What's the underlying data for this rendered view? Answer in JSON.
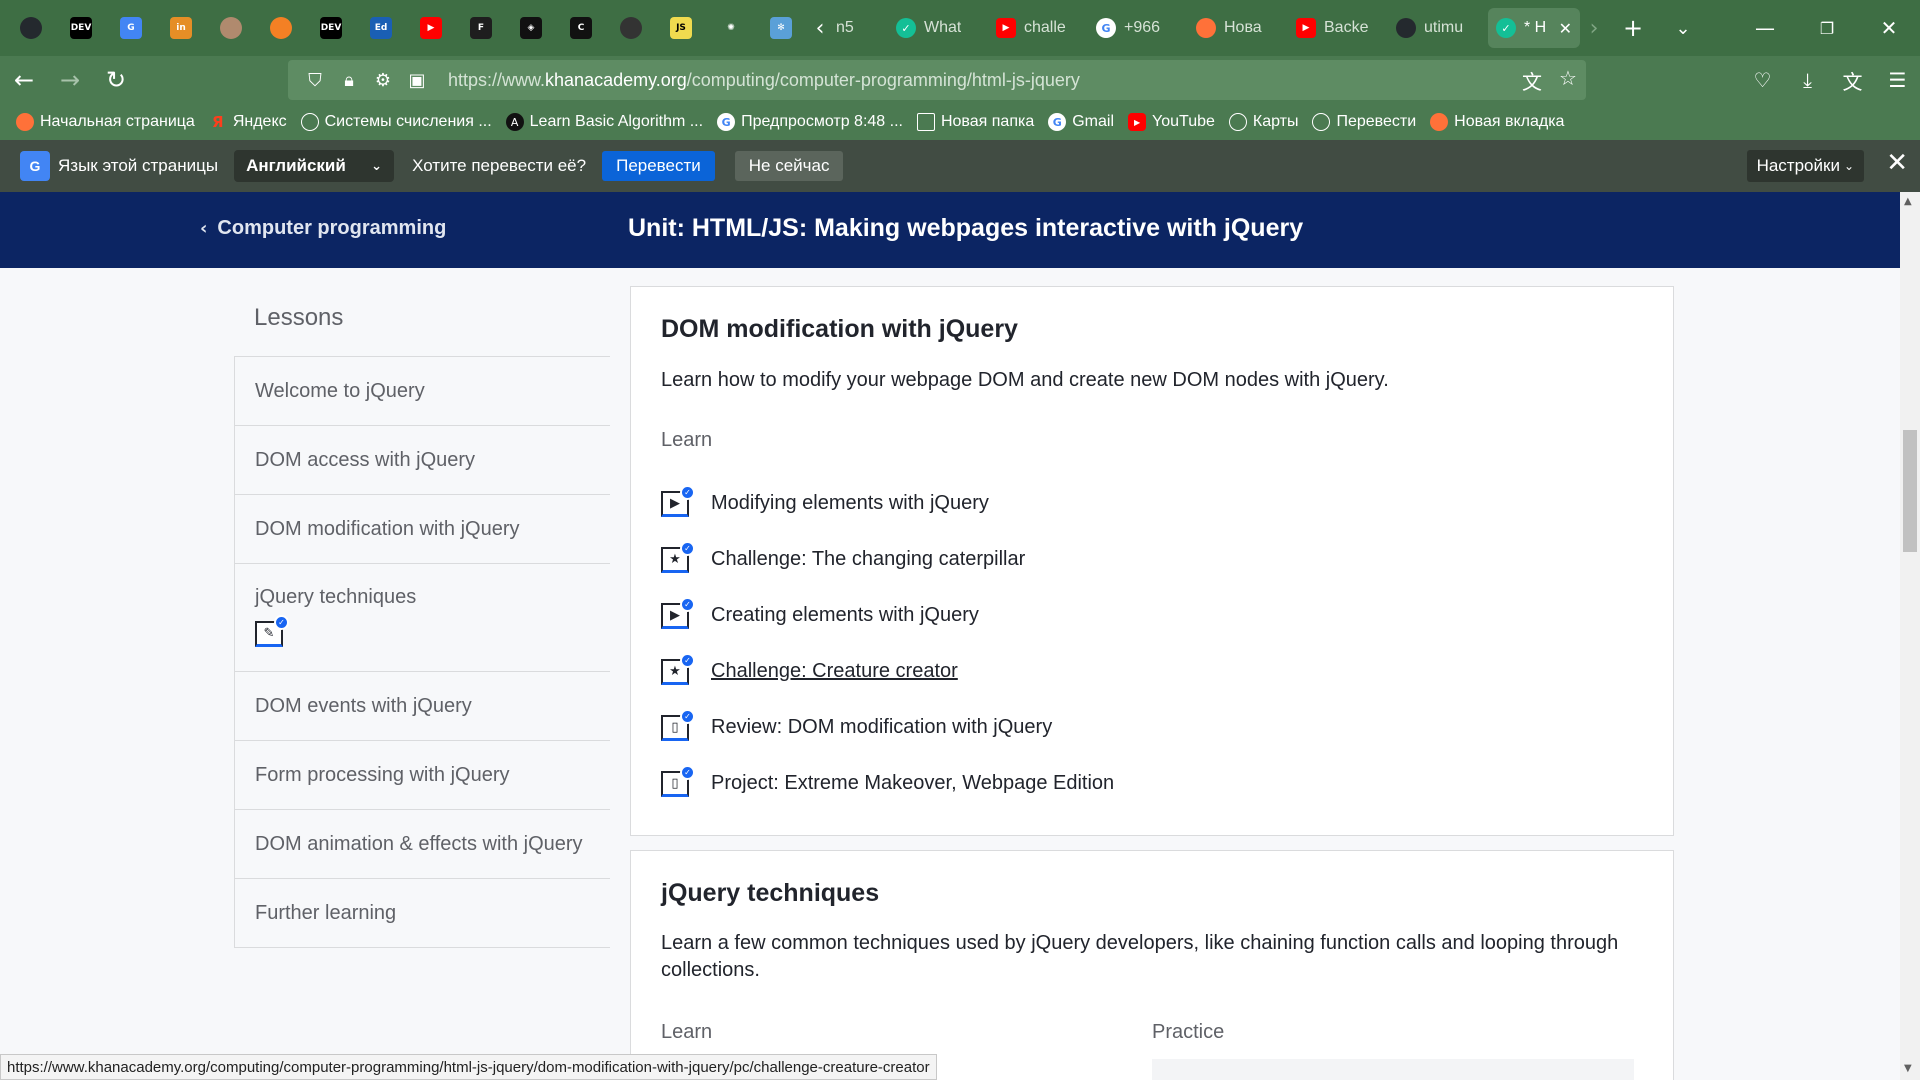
{
  "browser": {
    "pinned_tabs": [
      {
        "icon": "github-icon",
        "text": "",
        "color": "#24292e"
      },
      {
        "icon": "dev-icon",
        "text": "DEV",
        "color": "#000000"
      },
      {
        "icon": "google-translate-icon",
        "text": "G",
        "color": "#4285f4"
      },
      {
        "icon": "in-icon",
        "text": "in",
        "color": "#e58e26"
      },
      {
        "icon": "avatar-icon",
        "text": "",
        "color": "#b08a6e"
      },
      {
        "icon": "stack-icon",
        "text": "",
        "color": "#f48024"
      },
      {
        "icon": "dev-icon",
        "text": "DEV",
        "color": "#000000"
      },
      {
        "icon": "ed-icon",
        "text": "Ed",
        "color": "#1a5fb4"
      },
      {
        "icon": "youtube-icon",
        "text": "▶",
        "color": "#ff0000"
      },
      {
        "icon": "figma-icon",
        "text": "F",
        "color": "#1e1e1e"
      },
      {
        "icon": "codepen-icon",
        "text": "◈",
        "color": "#111111"
      },
      {
        "icon": "c-icon",
        "text": "C",
        "color": "#111111"
      },
      {
        "icon": "person-icon",
        "text": "",
        "color": "#333333"
      },
      {
        "icon": "js-icon",
        "text": "JS",
        "color": "#f0db4f"
      },
      {
        "icon": "openai-icon",
        "text": "✺",
        "color": "#3e6e44"
      },
      {
        "icon": "snowflake-icon",
        "text": "✻",
        "color": "#5aa0d8"
      }
    ],
    "tabs": [
      {
        "label": "n5",
        "icon": "",
        "color": ""
      },
      {
        "label": "What",
        "icon": "khan-icon",
        "color": "#14bf96"
      },
      {
        "label": "challe",
        "icon": "youtube-icon",
        "color": "#ff0000"
      },
      {
        "label": "+966",
        "icon": "google-icon",
        "color": "#ffffff"
      },
      {
        "label": "Нова",
        "icon": "firefox-icon",
        "color": "#ff7139"
      },
      {
        "label": "Backe",
        "icon": "youtube-icon",
        "color": "#ff0000"
      },
      {
        "label": "utimu",
        "icon": "github-icon",
        "color": "#24292e"
      }
    ],
    "active_tab": {
      "label": "* H",
      "close": "✕"
    },
    "url_prefix": "https://www.",
    "url_domain": "khanacademy.org",
    "url_path": "/computing/computer-programming/html-js-jquery",
    "bookmarks": [
      {
        "label": "Начальная страница",
        "icon": "firefox-icon",
        "color": "#ff7139"
      },
      {
        "label": "Яндекс",
        "icon": "yandex-icon",
        "color": "#fc3f1d"
      },
      {
        "label": "Системы счисления ...",
        "icon": "globe-icon",
        "color": "transparent"
      },
      {
        "label": "Learn Basic Algorithm ...",
        "icon": "algo-icon",
        "color": "#111111"
      },
      {
        "label": "Предпросмотр  8:48  ...",
        "icon": "google-icon",
        "color": "#ffffff"
      },
      {
        "label": "Новая папка",
        "icon": "folder-icon",
        "color": "transparent"
      },
      {
        "label": "Gmail",
        "icon": "google-icon",
        "color": "#ffffff"
      },
      {
        "label": "YouTube",
        "icon": "youtube-icon",
        "color": "#ff0000"
      },
      {
        "label": "Карты",
        "icon": "globe-icon",
        "color": "transparent"
      },
      {
        "label": "Перевести",
        "icon": "globe-icon",
        "color": "transparent"
      },
      {
        "label": "Новая вкладка",
        "icon": "firefox-icon",
        "color": "#ff7139"
      }
    ]
  },
  "translate": {
    "page_language_label": "Язык этой страницы",
    "language": "Английский",
    "question": "Хотите перевести её?",
    "translate_button": "Перевести",
    "not_now_button": "Не сейчас",
    "settings_button": "Настройки"
  },
  "header": {
    "back_label": "Computer programming",
    "title": "Unit: HTML/JS: Making webpages interactive with jQuery"
  },
  "sidebar": {
    "title": "Lessons",
    "lessons": [
      {
        "label": "Welcome to jQuery"
      },
      {
        "label": "DOM access with jQuery"
      },
      {
        "label": "DOM modification with jQuery"
      },
      {
        "label": "jQuery techniques"
      },
      {
        "label": "DOM events with jQuery"
      },
      {
        "label": "Form processing with jQuery"
      },
      {
        "label": "DOM animation & effects with jQuery"
      },
      {
        "label": "Further learning"
      }
    ]
  },
  "lesson1": {
    "title": "DOM modification with jQuery",
    "description": "Learn how to modify your webpage DOM and create new DOM nodes with jQuery.",
    "learn_label": "Learn",
    "items": [
      {
        "label": "Modifying elements with jQuery",
        "type": "video"
      },
      {
        "label": "Challenge: The changing caterpillar",
        "type": "challenge"
      },
      {
        "label": "Creating elements with jQuery",
        "type": "video"
      },
      {
        "label": "Challenge: Creature creator",
        "type": "challenge"
      },
      {
        "label": "Review: DOM modification with jQuery",
        "type": "article"
      },
      {
        "label": "Project: Extreme Makeover, Webpage Edition",
        "type": "article"
      }
    ]
  },
  "lesson2": {
    "title": "jQuery techniques",
    "description": "Learn a few common techniques used by jQuery developers, like chaining function calls and looping through collections.",
    "learn_label": "Learn",
    "practice_label": "Practice"
  },
  "status_url": "https://www.khanacademy.org/computing/computer-programming/html-js-jquery/dom-modification-with-jquery/pc/challenge-creature-creator",
  "colors": {
    "accent": "#1865f2",
    "header_bg": "#0c2563",
    "browser_green": "#3e6e44"
  }
}
